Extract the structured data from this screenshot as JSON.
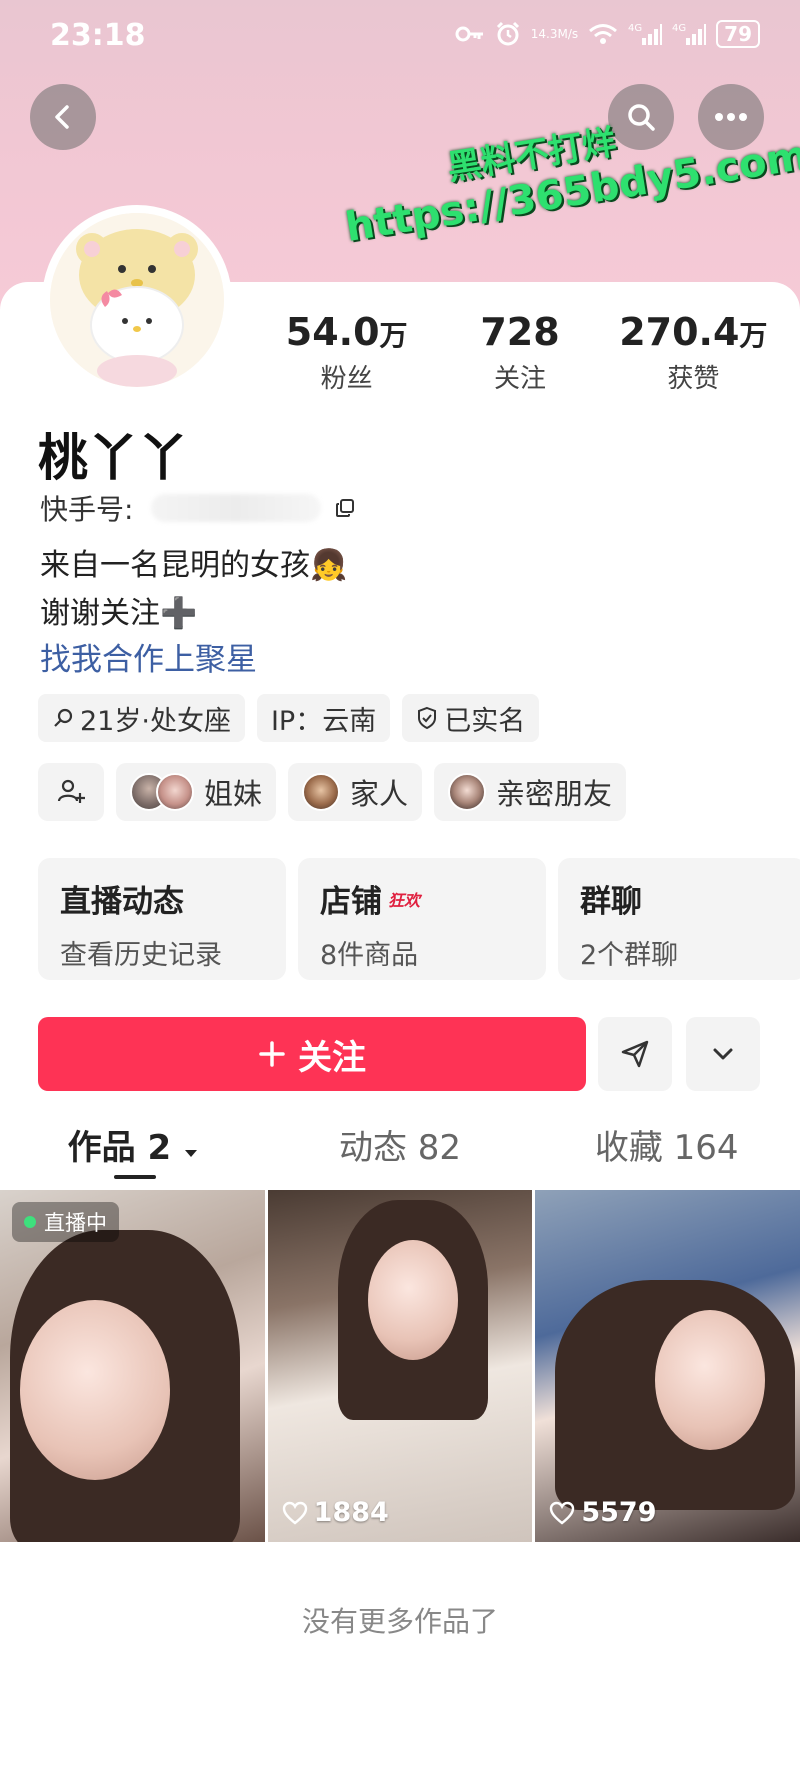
{
  "status_bar": {
    "time": "23:18",
    "net_speed_value": "14.3",
    "net_speed_unit": "M/s",
    "signal1": "4G",
    "signal2": "4G",
    "battery": "79"
  },
  "watermark": {
    "line1": "黑料不打烊",
    "line2": "https://365bdy5.com"
  },
  "stats": [
    {
      "value": "54.0",
      "unit": "万",
      "label": "粉丝"
    },
    {
      "value": "728",
      "unit": "",
      "label": "关注"
    },
    {
      "value": "270.4",
      "unit": "万",
      "label": "获赞"
    }
  ],
  "profile": {
    "nickname": "桃丫丫",
    "id_label": "快手号:",
    "bio_line1": "来自一名昆明的女孩👧",
    "bio_line2": "谢谢关注➕",
    "business_link": "找我合作上聚星"
  },
  "tags": {
    "age_zodiac": "21岁·处女座",
    "ip": "IP：云南",
    "verified": "已实名"
  },
  "relations": [
    {
      "label": "姐妹"
    },
    {
      "label": "家人"
    },
    {
      "label": "亲密朋友"
    }
  ],
  "cards": [
    {
      "title": "直播动态",
      "sub": "查看历史记录",
      "badge": ""
    },
    {
      "title": "店铺",
      "sub": "8件商品",
      "badge": "狂欢"
    },
    {
      "title": "群聊",
      "sub": "2个群聊",
      "badge": ""
    }
  ],
  "follow_button": {
    "label": "关注"
  },
  "tabs": [
    {
      "label": "作品 2"
    },
    {
      "label": "动态 82"
    },
    {
      "label": "收藏 164"
    }
  ],
  "works": [
    {
      "live_badge": "直播中",
      "likes": ""
    },
    {
      "live_badge": "",
      "likes": "1884"
    },
    {
      "live_badge": "",
      "likes": "5579"
    }
  ],
  "footer": {
    "no_more": "没有更多作品了"
  },
  "colors": {
    "accent": "#fe3355",
    "link": "#3d5fa3",
    "watermark": "#2ee06f"
  }
}
